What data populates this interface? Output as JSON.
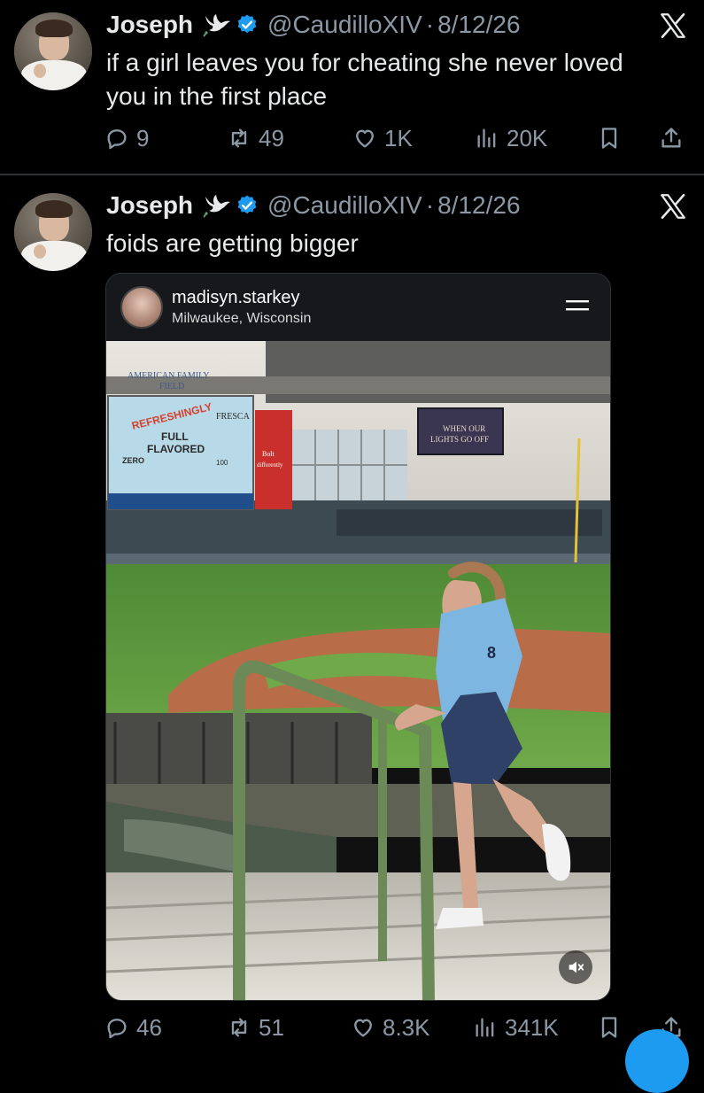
{
  "tweets": [
    {
      "name": "Joseph",
      "handle": "@CaudilloXIV",
      "separator": "·",
      "date": "8/12/26",
      "text_lines": [
        "if a girl leaves you for cheating she never loved",
        "you in the first place"
      ],
      "replies": "9",
      "retweets": "49",
      "likes": "1K",
      "views": "20K"
    },
    {
      "name": "Joseph",
      "handle": "@CaudilloXIV",
      "separator": "·",
      "date": "8/12/26",
      "text_lines": [
        "foids are getting bigger"
      ],
      "replies": "46",
      "retweets": "51",
      "likes": "8.3K",
      "views": "341K",
      "embed": {
        "username": "madisyn.starkey",
        "location": "Milwaukee, Wisconsin",
        "scoreboard_lines": [
          "AMERICAN FAMILY",
          "FIELD"
        ],
        "ad_lines": [
          "REFRESHINGLY",
          "FULL",
          "FLAVORED",
          "FRESCA",
          "ZERO",
          "100"
        ],
        "sign_lines": [
          "WHEN OUR",
          "LIGHTS GO OFF"
        ],
        "small_ad_lines": [
          "Bolt",
          "differently"
        ],
        "jersey_number": "8"
      }
    }
  ],
  "colors": {
    "background": "#000000",
    "text": "#e7e9ea",
    "muted": "#8b98a5",
    "verified": "#1d9bf0",
    "divider": "#2f3336"
  },
  "icons": [
    "dove-icon",
    "verified-icon",
    "x-logo-icon",
    "reply-icon",
    "retweet-icon",
    "like-icon",
    "views-icon",
    "bookmark-icon",
    "share-icon",
    "menu-icon",
    "mute-icon"
  ]
}
